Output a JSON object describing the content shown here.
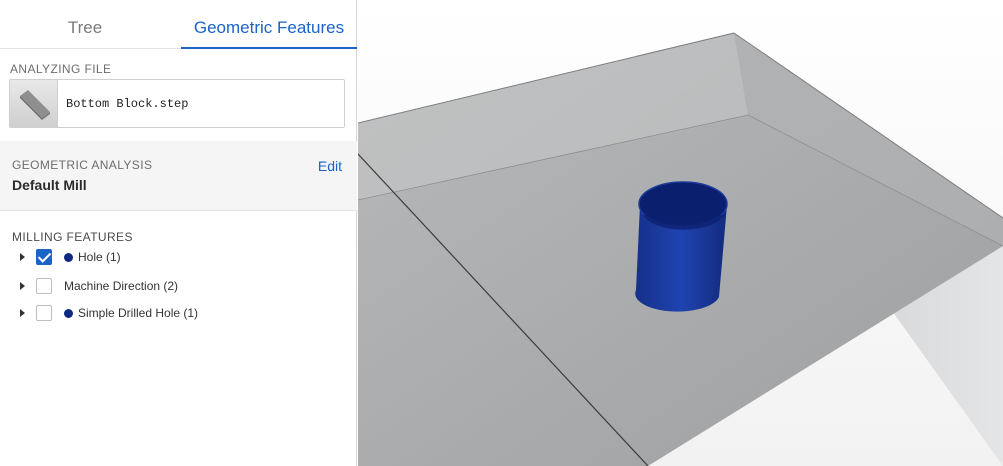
{
  "tabs": [
    {
      "label": "Tree",
      "active": false
    },
    {
      "label": "Geometric Features",
      "active": true
    }
  ],
  "analyzing_file": {
    "label": "ANALYZING FILE",
    "file_name": "Bottom Block.step"
  },
  "geometric_analysis": {
    "label": "GEOMETRIC ANALYSIS",
    "value": "Default Mill",
    "edit_label": "Edit"
  },
  "milling_features": {
    "label": "MILLING FEATURES",
    "items": [
      {
        "label": "Hole (1)",
        "checked": true,
        "dot_color": "#0d2a80"
      },
      {
        "label": "Machine Direction (2)",
        "checked": false,
        "dot_color": null
      },
      {
        "label": "Simple Drilled Hole (1)",
        "checked": false,
        "dot_color": "#0d2a80"
      }
    ]
  },
  "colors": {
    "accent": "#1a63c7",
    "feature_blue": "#0d2a80",
    "model_gray": "#9fa1a3"
  }
}
